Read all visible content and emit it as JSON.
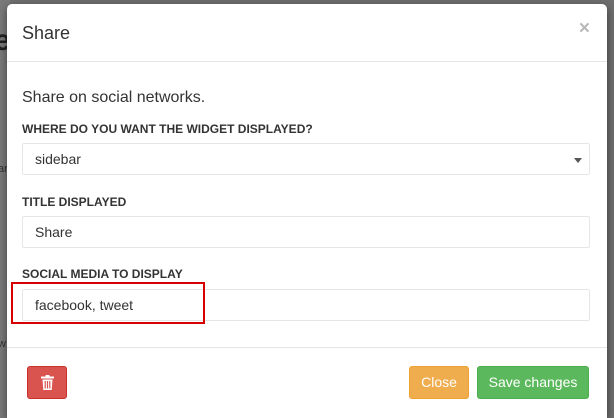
{
  "backdrop": {
    "heading_fragment": "e",
    "text_fragment_ar": "ar",
    "text_fragment_w": "w"
  },
  "modal": {
    "title": "Share",
    "close_symbol": "×",
    "intro": "Share on social networks.",
    "fields": {
      "widget_location": {
        "label": "WHERE DO YOU WANT THE WIDGET DISPLAYED?",
        "value": "sidebar"
      },
      "title_displayed": {
        "label": "TITLE DISPLAYED",
        "value": "Share"
      },
      "social_media": {
        "label": "SOCIAL MEDIA TO DISPLAY",
        "value": "facebook, tweet"
      }
    },
    "footer": {
      "delete_icon": "trash-icon",
      "close_label": "Close",
      "save_label": "Save changes"
    }
  },
  "colors": {
    "delete": "#d9534f",
    "close": "#f0ad4e",
    "save": "#5cb85c",
    "highlight": "#d60000"
  }
}
